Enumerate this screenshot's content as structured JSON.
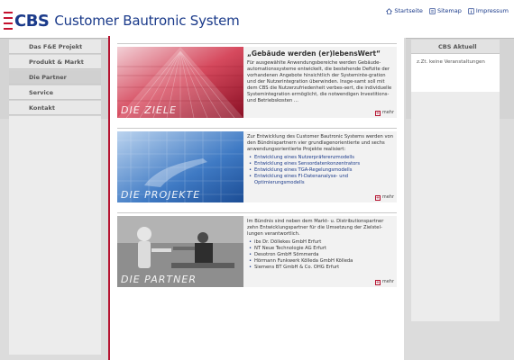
{
  "header": {
    "logo_mark": "CBS",
    "logo_text": "Customer Bautronic System",
    "links": [
      {
        "label": "Startseite",
        "icon": "home-icon"
      },
      {
        "label": "Sitemap",
        "icon": "sitemap-icon"
      },
      {
        "label": "Impressum",
        "icon": "info-icon"
      }
    ]
  },
  "sidebar": {
    "items": [
      {
        "label": "Das F&E Projekt"
      },
      {
        "label": "Produkt & Markt"
      },
      {
        "label": "Die Partner"
      },
      {
        "label": "Service"
      },
      {
        "label": "Kontakt"
      }
    ]
  },
  "teasers": [
    {
      "image_label": "DIE ZIELE",
      "heading": "„Gebäude werden (er)lebensWert“",
      "paragraph": "Für ausgewählte Anwendungsbereiche werden Gebäude-automationssysteme entwickelt, die bestehende Defizite der vorhandenen Angebote hinsichtlich der Systeminte-gration und der Nutzerintegration überwinden. Insge-samt soll mit dem CBS die Nutzerzufriedenheit verbes-sert, die individuelle Systemintegration ermöglicht, die notwendigen Investitions- und Betriebskosten ...",
      "items": [],
      "more": "mehr"
    },
    {
      "image_label": "DIE PROJEKTE",
      "heading": "",
      "paragraph": "Zur Entwicklung des Customer Bautronic Systems werden von den Bündnispartnern vier grundlagenorientierte und sechs anwendungsorientierte Projekte realisiert:",
      "items": [
        "Entwicklung eines Nutzerpräferenzmodells",
        "Entwicklung eines Sensordatenkonzentrators",
        "Entwicklung eines TGA-Regelungsmodells",
        "Entwicklung eines FI-Datenanalyse- und Optimierungsmodells"
      ],
      "more": "mehr"
    },
    {
      "image_label": "DIE PARTNER",
      "heading": "",
      "paragraph": "Im Bündnis sind neben dem Markt- u. Distributionspartner zehn Entwicklungspartner für die Umsetzung der Zielstel-lungen verantwortlich.",
      "items": [
        "ibs Dr. Döllekes GmbH Erfurt",
        "NT Neue Technologie AG Erfurt",
        "Desotron GmbH Sömmerda",
        "Hörmann Funkwerk Kölleda GmbH Kölleda",
        "Siemens BT GmbH & Co. OHG Erfurt"
      ],
      "more": "mehr"
    }
  ],
  "right_panel": {
    "title": "CBS Aktuell",
    "text": "z.Zt. keine Veranstaltungen"
  },
  "colors": {
    "accent_red": "#b5122f",
    "brand_blue": "#1a3a8a"
  }
}
